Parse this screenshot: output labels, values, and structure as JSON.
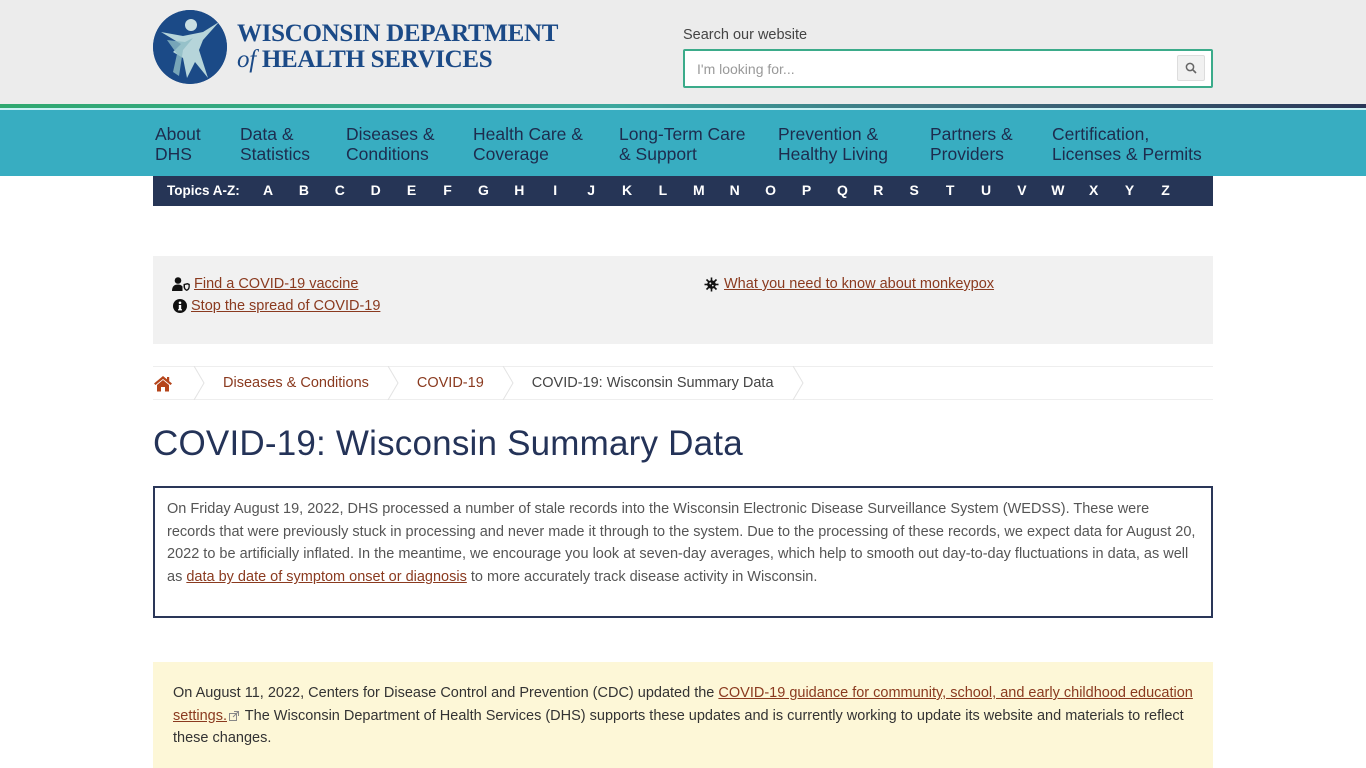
{
  "header": {
    "logo": {
      "line1": "WISCONSIN DEPARTMENT",
      "line2_of": "of",
      "line2": "HEALTH SERVICES",
      "seal_icon": "dhs-seal-icon"
    },
    "search": {
      "label": "Search our website",
      "placeholder": "I'm looking for...",
      "value": "",
      "button_icon": "search-icon"
    }
  },
  "mainnav": {
    "items": [
      {
        "line1": "About",
        "line2": "DHS"
      },
      {
        "line1": "Data &",
        "line2": "Statistics"
      },
      {
        "line1": "Diseases &",
        "line2": "Conditions"
      },
      {
        "line1": "Health Care &",
        "line2": "Coverage"
      },
      {
        "line1": "Long-Term Care",
        "line2": "& Support"
      },
      {
        "line1": "Prevention &",
        "line2": "Healthy Living"
      },
      {
        "line1": "Partners &",
        "line2": "Providers"
      },
      {
        "line1": "Certification,",
        "line2": "Licenses & Permits"
      }
    ]
  },
  "topics": {
    "label": "Topics A-Z:",
    "letters": [
      "A",
      "B",
      "C",
      "D",
      "E",
      "F",
      "G",
      "H",
      "I",
      "J",
      "K",
      "L",
      "M",
      "N",
      "O",
      "P",
      "Q",
      "R",
      "S",
      "T",
      "U",
      "V",
      "W",
      "X",
      "Y",
      "Z"
    ]
  },
  "alerts": {
    "vaccine": {
      "icon": "user-shield-icon",
      "text": "Find a COVID-19 vaccine"
    },
    "spread": {
      "icon": "info-circle-icon",
      "text": "Stop the spread of COVID-19"
    },
    "monkeypox": {
      "icon": "virus-icon",
      "text": "What you need to know about monkeypox"
    }
  },
  "breadcrumb": {
    "home_icon": "home-icon",
    "items": [
      {
        "label": "Diseases & Conditions"
      },
      {
        "label": "COVID-19"
      },
      {
        "label": "COVID-19: Wisconsin Summary Data"
      }
    ]
  },
  "page": {
    "title": "COVID-19: Wisconsin Summary Data"
  },
  "notice": {
    "text_before": "On Friday August 19, 2022, DHS processed a number of stale records into the Wisconsin Electronic Disease Surveillance System (WEDSS). These were records that were previously stuck in processing and never made it through to the system. Due to the processing of these records, we expect data for August 20, 2022 to be artificially inflated. In the meantime, we encourage you look at seven-day averages, which help to smooth out day-to-day fluctuations in data, as well as ",
    "link": "data by date of symptom onset or diagnosis",
    "text_after": " to more accurately track disease activity in Wisconsin."
  },
  "cdc": {
    "text_before": "On August 11, 2022, Centers for Disease Control and Prevention (CDC) updated the ",
    "link": "COVID-19 guidance for community, school, and early childhood education settings.",
    "link_icon": "external-link-icon",
    "text_after": " The Wisconsin Department of Health Services (DHS) supports these updates and is currently working to update its website and materials to reflect these changes."
  }
}
